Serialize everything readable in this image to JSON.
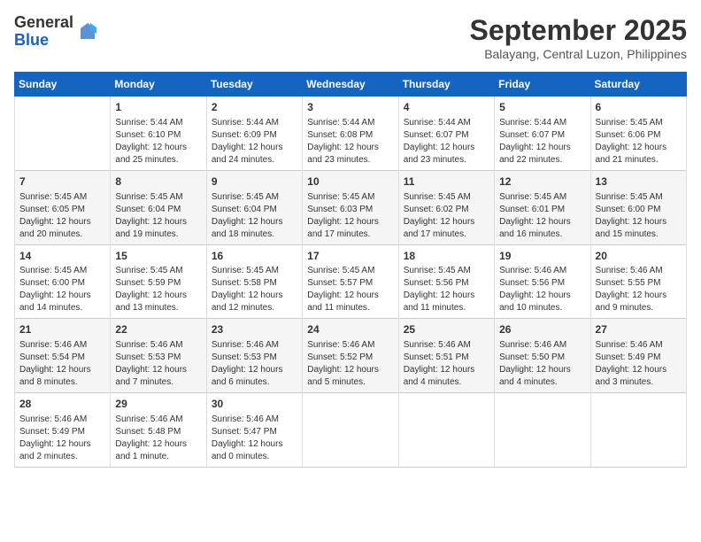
{
  "logo": {
    "general": "General",
    "blue": "Blue"
  },
  "header": {
    "month": "September 2025",
    "location": "Balayang, Central Luzon, Philippines"
  },
  "days_of_week": [
    "Sunday",
    "Monday",
    "Tuesday",
    "Wednesday",
    "Thursday",
    "Friday",
    "Saturday"
  ],
  "weeks": [
    [
      {
        "day": "",
        "info": ""
      },
      {
        "day": "1",
        "info": "Sunrise: 5:44 AM\nSunset: 6:10 PM\nDaylight: 12 hours\nand 25 minutes."
      },
      {
        "day": "2",
        "info": "Sunrise: 5:44 AM\nSunset: 6:09 PM\nDaylight: 12 hours\nand 24 minutes."
      },
      {
        "day": "3",
        "info": "Sunrise: 5:44 AM\nSunset: 6:08 PM\nDaylight: 12 hours\nand 23 minutes."
      },
      {
        "day": "4",
        "info": "Sunrise: 5:44 AM\nSunset: 6:07 PM\nDaylight: 12 hours\nand 23 minutes."
      },
      {
        "day": "5",
        "info": "Sunrise: 5:44 AM\nSunset: 6:07 PM\nDaylight: 12 hours\nand 22 minutes."
      },
      {
        "day": "6",
        "info": "Sunrise: 5:45 AM\nSunset: 6:06 PM\nDaylight: 12 hours\nand 21 minutes."
      }
    ],
    [
      {
        "day": "7",
        "info": "Sunrise: 5:45 AM\nSunset: 6:05 PM\nDaylight: 12 hours\nand 20 minutes."
      },
      {
        "day": "8",
        "info": "Sunrise: 5:45 AM\nSunset: 6:04 PM\nDaylight: 12 hours\nand 19 minutes."
      },
      {
        "day": "9",
        "info": "Sunrise: 5:45 AM\nSunset: 6:04 PM\nDaylight: 12 hours\nand 18 minutes."
      },
      {
        "day": "10",
        "info": "Sunrise: 5:45 AM\nSunset: 6:03 PM\nDaylight: 12 hours\nand 17 minutes."
      },
      {
        "day": "11",
        "info": "Sunrise: 5:45 AM\nSunset: 6:02 PM\nDaylight: 12 hours\nand 17 minutes."
      },
      {
        "day": "12",
        "info": "Sunrise: 5:45 AM\nSunset: 6:01 PM\nDaylight: 12 hours\nand 16 minutes."
      },
      {
        "day": "13",
        "info": "Sunrise: 5:45 AM\nSunset: 6:00 PM\nDaylight: 12 hours\nand 15 minutes."
      }
    ],
    [
      {
        "day": "14",
        "info": "Sunrise: 5:45 AM\nSunset: 6:00 PM\nDaylight: 12 hours\nand 14 minutes."
      },
      {
        "day": "15",
        "info": "Sunrise: 5:45 AM\nSunset: 5:59 PM\nDaylight: 12 hours\nand 13 minutes."
      },
      {
        "day": "16",
        "info": "Sunrise: 5:45 AM\nSunset: 5:58 PM\nDaylight: 12 hours\nand 12 minutes."
      },
      {
        "day": "17",
        "info": "Sunrise: 5:45 AM\nSunset: 5:57 PM\nDaylight: 12 hours\nand 11 minutes."
      },
      {
        "day": "18",
        "info": "Sunrise: 5:45 AM\nSunset: 5:56 PM\nDaylight: 12 hours\nand 11 minutes."
      },
      {
        "day": "19",
        "info": "Sunrise: 5:46 AM\nSunset: 5:56 PM\nDaylight: 12 hours\nand 10 minutes."
      },
      {
        "day": "20",
        "info": "Sunrise: 5:46 AM\nSunset: 5:55 PM\nDaylight: 12 hours\nand 9 minutes."
      }
    ],
    [
      {
        "day": "21",
        "info": "Sunrise: 5:46 AM\nSunset: 5:54 PM\nDaylight: 12 hours\nand 8 minutes."
      },
      {
        "day": "22",
        "info": "Sunrise: 5:46 AM\nSunset: 5:53 PM\nDaylight: 12 hours\nand 7 minutes."
      },
      {
        "day": "23",
        "info": "Sunrise: 5:46 AM\nSunset: 5:53 PM\nDaylight: 12 hours\nand 6 minutes."
      },
      {
        "day": "24",
        "info": "Sunrise: 5:46 AM\nSunset: 5:52 PM\nDaylight: 12 hours\nand 5 minutes."
      },
      {
        "day": "25",
        "info": "Sunrise: 5:46 AM\nSunset: 5:51 PM\nDaylight: 12 hours\nand 4 minutes."
      },
      {
        "day": "26",
        "info": "Sunrise: 5:46 AM\nSunset: 5:50 PM\nDaylight: 12 hours\nand 4 minutes."
      },
      {
        "day": "27",
        "info": "Sunrise: 5:46 AM\nSunset: 5:49 PM\nDaylight: 12 hours\nand 3 minutes."
      }
    ],
    [
      {
        "day": "28",
        "info": "Sunrise: 5:46 AM\nSunset: 5:49 PM\nDaylight: 12 hours\nand 2 minutes."
      },
      {
        "day": "29",
        "info": "Sunrise: 5:46 AM\nSunset: 5:48 PM\nDaylight: 12 hours\nand 1 minute."
      },
      {
        "day": "30",
        "info": "Sunrise: 5:46 AM\nSunset: 5:47 PM\nDaylight: 12 hours\nand 0 minutes."
      },
      {
        "day": "",
        "info": ""
      },
      {
        "day": "",
        "info": ""
      },
      {
        "day": "",
        "info": ""
      },
      {
        "day": "",
        "info": ""
      }
    ]
  ]
}
